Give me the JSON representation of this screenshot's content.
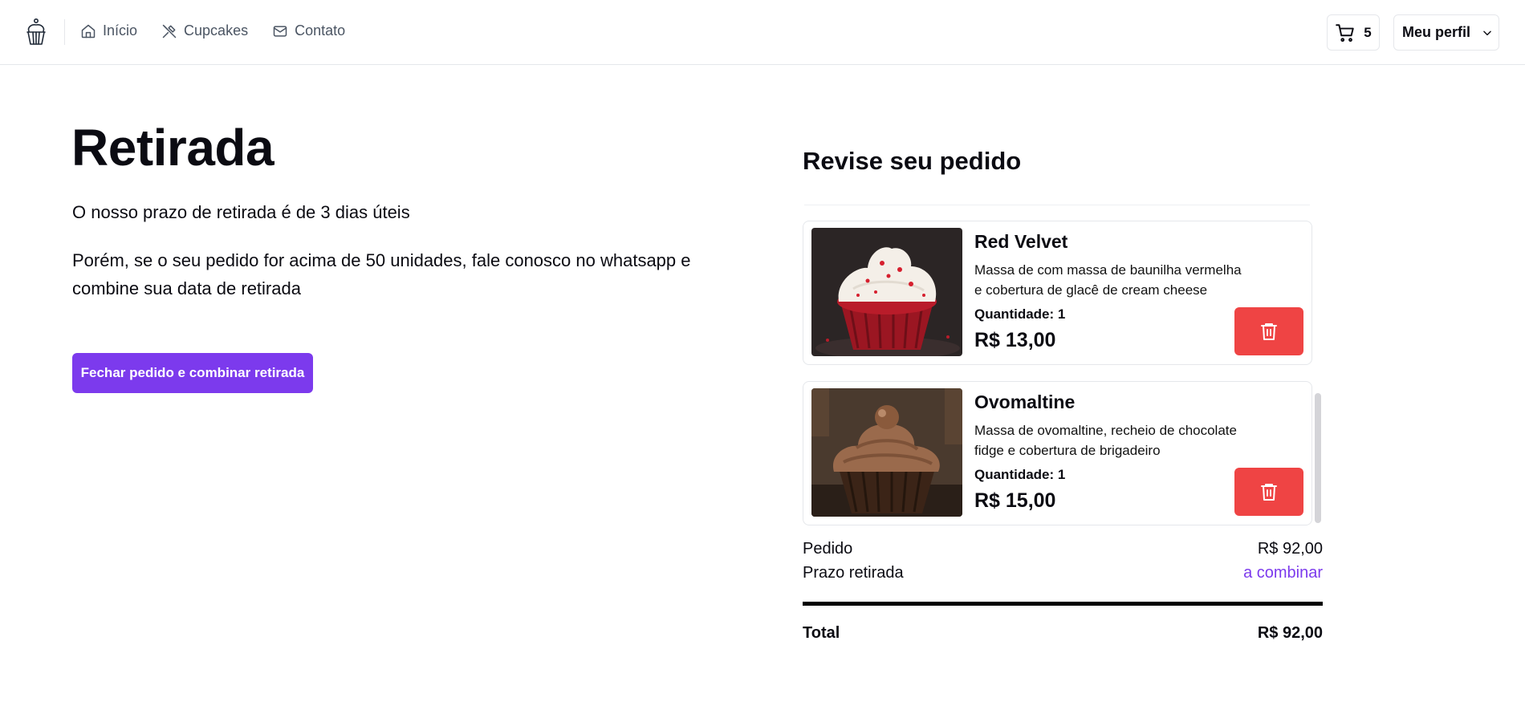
{
  "header": {
    "nav": [
      {
        "label": "Início",
        "icon": "home-icon"
      },
      {
        "label": "Cupcakes",
        "icon": "utensils-crossed-icon"
      },
      {
        "label": "Contato",
        "icon": "mail-icon"
      }
    ],
    "cart_count": "5",
    "profile_label": "Meu perfil"
  },
  "main": {
    "title": "Retirada",
    "paragraph1": "O nosso prazo de retirada é de 3 dias úteis",
    "paragraph2": "Porém, se o seu pedido for acima de 50 unidades, fale conosco no whatsapp e combine sua data de retirada",
    "cta_label": "Fechar pedido e combinar retirada"
  },
  "review": {
    "title": "Revise seu pedido",
    "items": [
      {
        "name": "Red Velvet",
        "description": "Massa de com massa de baunilha vermelha e cobertura de glacê de cream cheese",
        "quantity": "Quantidade: 1",
        "price": "R$ 13,00"
      },
      {
        "name": "Ovomaltine",
        "description": "Massa de ovomaltine, recheio de chocolate fidge e cobertura de brigadeiro",
        "quantity": "Quantidade: 1",
        "price": "R$ 15,00"
      }
    ],
    "summary": {
      "order_label": "Pedido",
      "order_value": "R$ 92,00",
      "pickup_label": "Prazo retirada",
      "pickup_value": "a combinar",
      "total_label": "Total",
      "total_value": "R$ 92,00"
    }
  },
  "colors": {
    "accent": "#7c3aed",
    "danger": "#ef4444",
    "border": "#e5e7eb",
    "nav_text": "#4b5563"
  }
}
